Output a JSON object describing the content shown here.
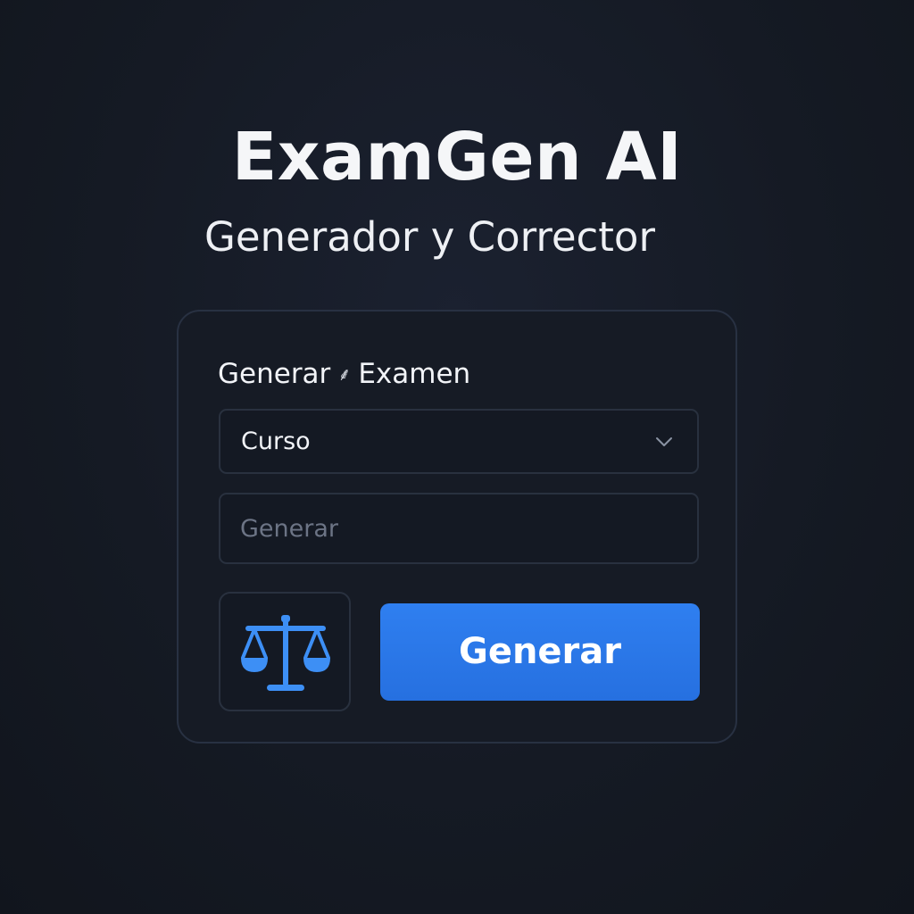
{
  "app": {
    "title": "ExamGen AI",
    "subtitle": "Generador y Corrector"
  },
  "card": {
    "heading_left": "Generar",
    "heading_separator": "⸙",
    "heading_right": "Examen",
    "course_select": {
      "selected_value": "Curso",
      "icon": "chevron-down-icon"
    },
    "prompt_input": {
      "value": "",
      "placeholder": "Generar"
    },
    "scale_button": {
      "icon": "scale-icon"
    },
    "generate_button": {
      "label": "Generar"
    }
  },
  "colors": {
    "background": "#151a24",
    "card_border": "#283142",
    "accent": "#2a74e6",
    "icon_accent": "#3d8ff5",
    "placeholder": "#6c7485"
  }
}
